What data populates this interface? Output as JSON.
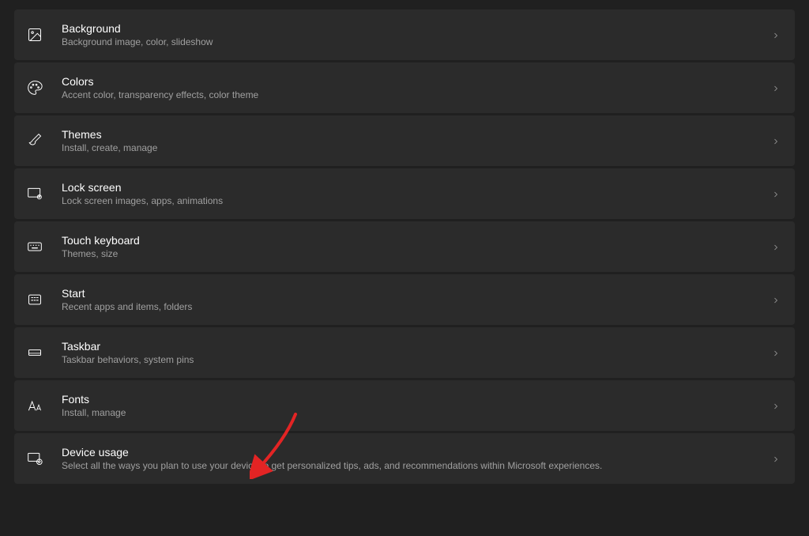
{
  "settings": [
    {
      "id": "background",
      "title": "Background",
      "desc": "Background image, color, slideshow"
    },
    {
      "id": "colors",
      "title": "Colors",
      "desc": "Accent color, transparency effects, color theme"
    },
    {
      "id": "themes",
      "title": "Themes",
      "desc": "Install, create, manage"
    },
    {
      "id": "lockscreen",
      "title": "Lock screen",
      "desc": "Lock screen images, apps, animations"
    },
    {
      "id": "touchkeyboard",
      "title": "Touch keyboard",
      "desc": "Themes, size"
    },
    {
      "id": "start",
      "title": "Start",
      "desc": "Recent apps and items, folders"
    },
    {
      "id": "taskbar",
      "title": "Taskbar",
      "desc": "Taskbar behaviors, system pins"
    },
    {
      "id": "fonts",
      "title": "Fonts",
      "desc": "Install, manage"
    },
    {
      "id": "deviceusage",
      "title": "Device usage",
      "desc": "Select all the ways you plan to use your device to get personalized tips, ads, and recommendations within Microsoft experiences."
    }
  ]
}
